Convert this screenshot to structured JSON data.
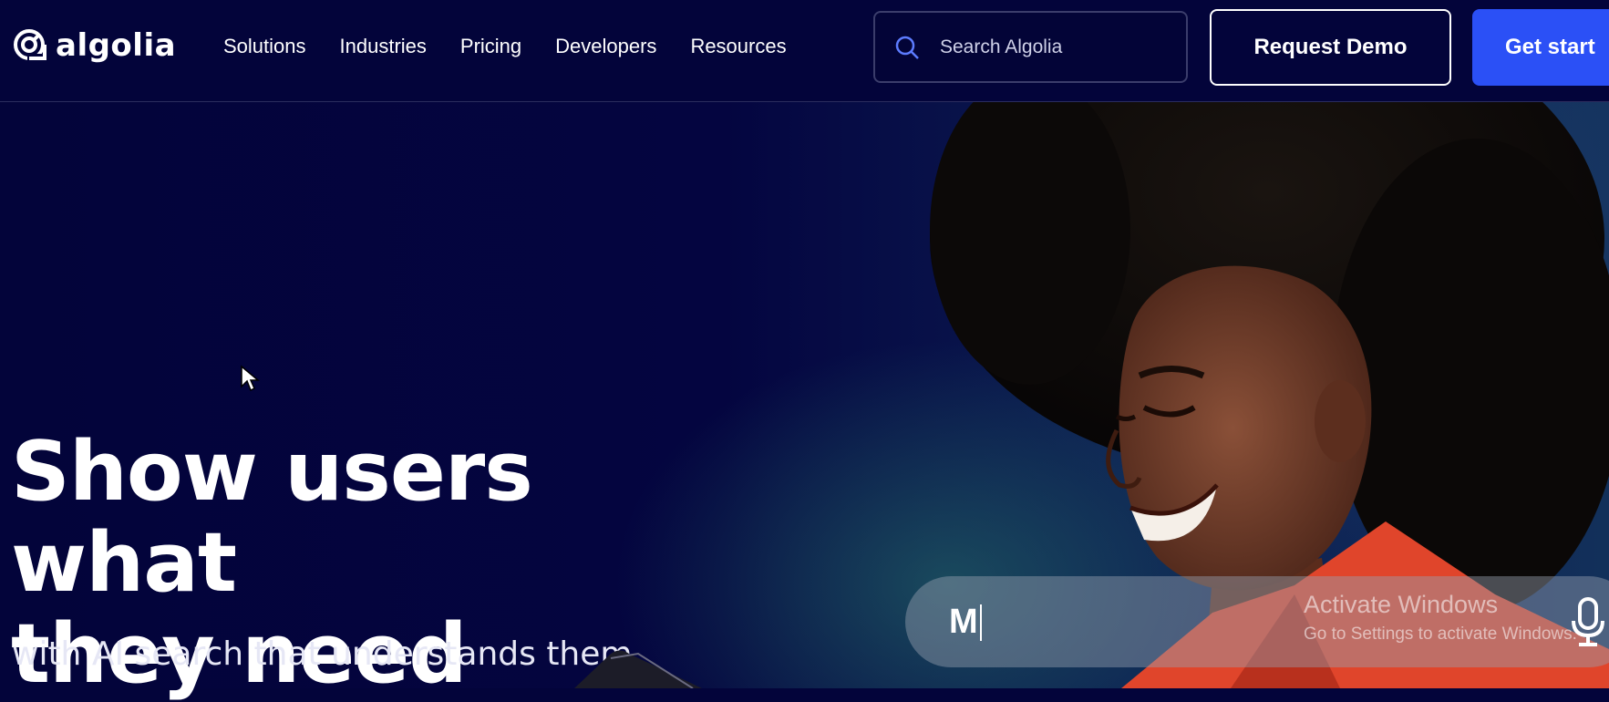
{
  "brand": {
    "name": "algolia"
  },
  "nav": {
    "links": [
      "Solutions",
      "Industries",
      "Pricing",
      "Developers",
      "Resources"
    ]
  },
  "search": {
    "placeholder": "Search Algolia"
  },
  "actions": {
    "request_demo": "Request Demo",
    "get_started": "Get start"
  },
  "hero": {
    "headline_line1": "Show users what",
    "headline_line2": "they need",
    "subheadline": "with AI search that understands them",
    "demo_query": "M"
  },
  "watermark": {
    "title": "Activate Windows",
    "subtitle": "Go to Settings to activate Windows."
  },
  "colors": {
    "background": "#03043a",
    "accent": "#2b50f6",
    "jacket": "#e0452b"
  }
}
